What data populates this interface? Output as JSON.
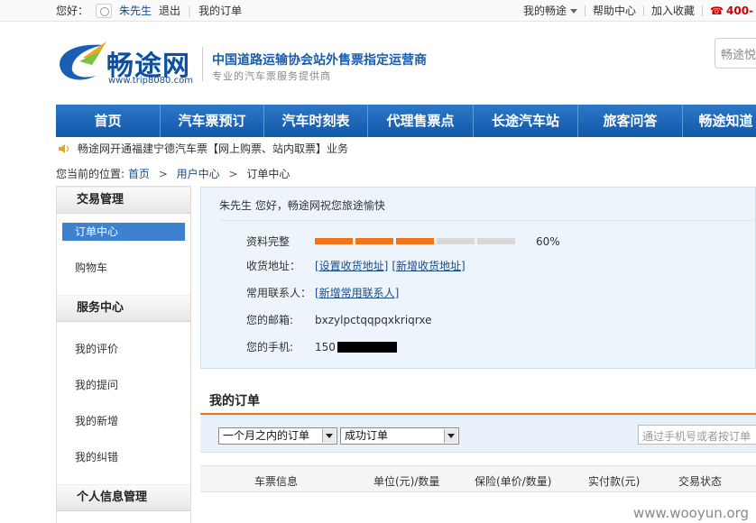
{
  "topbar": {
    "greeting": "您好：",
    "user_name": "朱先生",
    "logout": "退出",
    "my_orders": "我的订单",
    "my_changtu": "我的畅途",
    "help": "帮助中心",
    "favorite": "加入收藏",
    "phone": "400-"
  },
  "header": {
    "brand": "畅途网",
    "url": "www.trip8080.com",
    "slogan": "中国道路运输协会站外售票指定运营商",
    "subslogan": "专业的汽车票服务提供商",
    "search_placeholder": "畅途悦"
  },
  "nav": {
    "items": [
      "首页",
      "汽车票预订",
      "汽车时刻表",
      "代理售票点",
      "长途汽车站",
      "旅客问答",
      "畅途知道"
    ]
  },
  "notice": "畅途网开通福建宁德汽车票【网上购票、站内取票】业务",
  "breadcrumb": {
    "prefix": "您当前的位置:",
    "home": "首页",
    "user_center": "用户中心",
    "current": "订单中心"
  },
  "sidebar": {
    "section1": "交易管理",
    "order_center": "订单中心",
    "cart": "购物车",
    "section2": "服务中心",
    "my_reviews": "我的评价",
    "my_questions": "我的提问",
    "my_additions": "我的新增",
    "my_disputes": "我的纠错",
    "section3": "个人信息管理"
  },
  "profile": {
    "greeting": "朱先生   您好，畅途网祝您旅途愉快",
    "completeness_label": "资料完整",
    "completeness_value": 0.6,
    "completeness_text": "60%",
    "address_label": "收货地址：",
    "set_address": "[设置收货地址]",
    "add_address": "[新增收货地址]",
    "contacts_label": "常用联系人：",
    "add_contact": "[新增常用联系人]",
    "email_label": "您的邮箱:",
    "email": "bxzylpctqqpqxkriqrxe",
    "phone_label": "您的手机:",
    "phone_prefix": "150"
  },
  "orders": {
    "title": "我的订单",
    "period_select": "一个月之内的订单",
    "status_select": "成功订单",
    "search_placeholder": "通过手机号或者按订单",
    "columns": [
      "车票信息",
      "单位(元)/数量",
      "保险(单价/数量)",
      "实付款(元)",
      "交易状态"
    ]
  },
  "watermark": "www.wooyun.org",
  "colors": {
    "nav_blue": "#1a63b5",
    "accent_orange": "#f07318",
    "link_blue": "#1a4c8c"
  }
}
